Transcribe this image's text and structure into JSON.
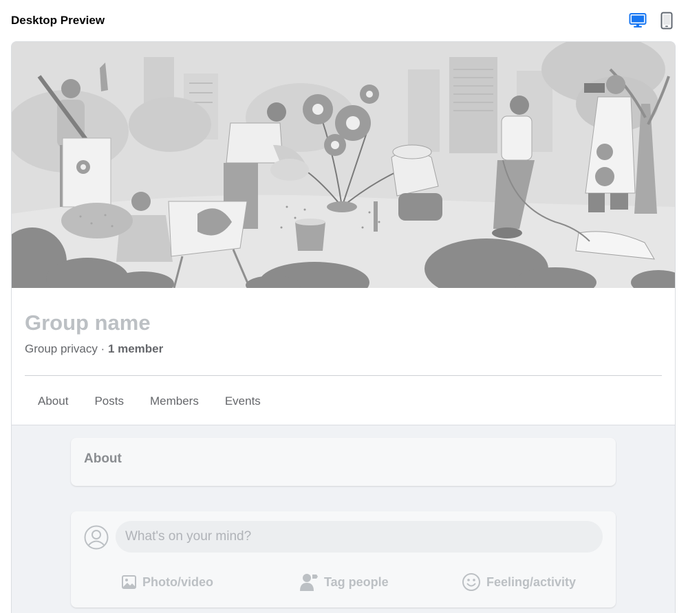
{
  "header": {
    "title": "Desktop Preview",
    "active_device": "desktop",
    "accent_color": "#1877f2",
    "devices": [
      {
        "name": "desktop",
        "icon": "monitor-icon"
      },
      {
        "name": "mobile",
        "icon": "phone-icon"
      }
    ]
  },
  "cover": {
    "icon": "community-garden-illustration"
  },
  "group": {
    "name": "Group name",
    "privacy": "Group privacy",
    "separator": " · ",
    "members": "1 member"
  },
  "tabs": [
    {
      "label": "About"
    },
    {
      "label": "Posts"
    },
    {
      "label": "Members"
    },
    {
      "label": "Events"
    }
  ],
  "about_card": {
    "title": "About"
  },
  "composer": {
    "placeholder": "What's on your mind?",
    "avatar_icon": "user-avatar-icon",
    "actions": [
      {
        "label": "Photo/video",
        "icon": "photo-icon"
      },
      {
        "label": "Tag people",
        "icon": "tag-people-icon"
      },
      {
        "label": "Feeling/activity",
        "icon": "smiley-icon"
      }
    ]
  }
}
